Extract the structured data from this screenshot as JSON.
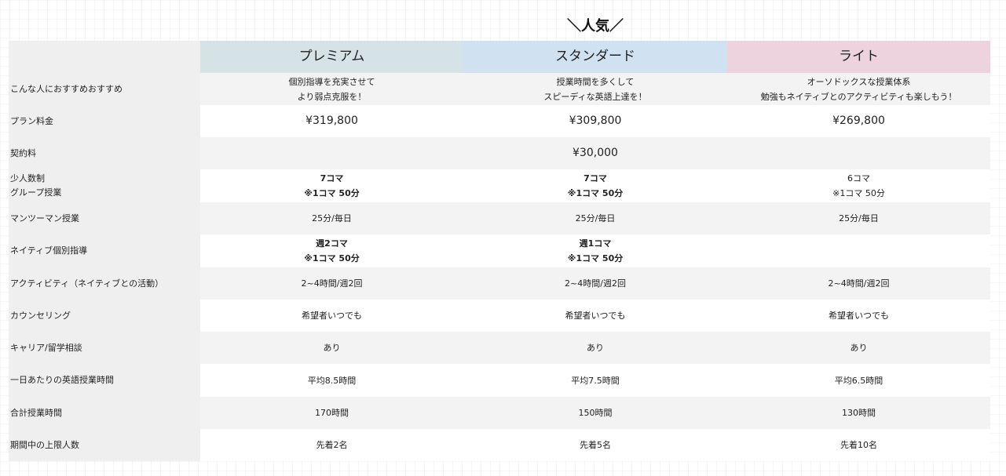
{
  "popular_label": "＼人気／",
  "headers": {
    "premium": "プレミアム",
    "standard": "スタンダード",
    "lite": "ライト"
  },
  "colors": {
    "premium": "#d5e3e6",
    "standard": "#d0e2f1",
    "lite": "#ecd3de",
    "label_bg": "#efefef",
    "stripe_bg": "#f3f3f3"
  },
  "rows": {
    "recommend": {
      "label": "こんな人におすすめおすすめ",
      "premium": "個別指導を充実させて\nより弱点克服を！",
      "standard": "授業時間を多くして\nスピーディな英語上達を！",
      "lite": "オーソドックスな授業体系\n勉強もネイティブとのアクティビティも楽しもう！"
    },
    "price": {
      "label": "プラン料金",
      "premium": "¥319,800",
      "standard": "¥309,800",
      "lite": "¥269,800"
    },
    "contract": {
      "label": "契約料",
      "all": "¥30,000"
    },
    "group": {
      "label": "少人数制\nグループ授業",
      "premium": "7コマ\n※1コマ 50分",
      "standard": "7コマ\n※1コマ 50分",
      "lite": "6コマ\n※1コマ 50分"
    },
    "mantoman": {
      "label": "マンツーマン授業",
      "premium": "25分/毎日",
      "standard": "25分/毎日",
      "lite": "25分/毎日"
    },
    "native": {
      "label": "ネイティブ個別指導",
      "premium": "週2コマ\n※1コマ 50分",
      "standard": "週1コマ\n※1コマ 50分",
      "lite": ""
    },
    "activity": {
      "label": "アクティビティ（ネイティブとの活動）",
      "premium": "2~4時間/週2回",
      "standard": "2~4時間/週2回",
      "lite": "2~4時間/週2回"
    },
    "counseling": {
      "label": "カウンセリング",
      "premium": "希望者いつでも",
      "standard": "希望者いつでも",
      "lite": "希望者いつでも"
    },
    "career": {
      "label": "キャリア/留学相談",
      "premium": "あり",
      "standard": "あり",
      "lite": "あり"
    },
    "daily_hours": {
      "label": "一日あたりの英語授業時間",
      "premium": "平均8.5時間",
      "standard": "平均7.5時間",
      "lite": "平均6.5時間"
    },
    "total_hours": {
      "label": "合計授業時間",
      "premium": "170時間",
      "standard": "150時間",
      "lite": "130時間"
    },
    "capacity": {
      "label": "期間中の上限人数",
      "premium": "先着2名",
      "standard": "先着5名",
      "lite": "先着10名"
    }
  }
}
